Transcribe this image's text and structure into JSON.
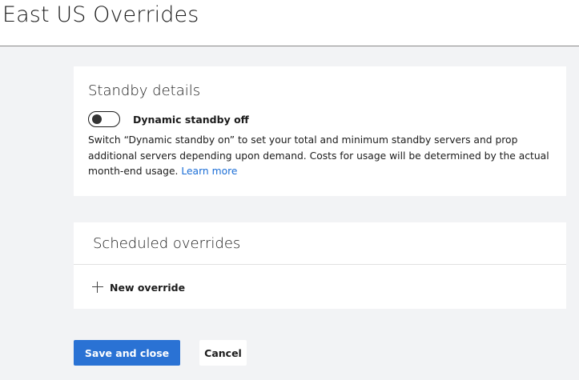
{
  "header": {
    "title": "East US Overrides"
  },
  "standby": {
    "title": "Standby details",
    "toggle": {
      "label": "Dynamic standby off",
      "state": "off"
    },
    "description": "Switch “Dynamic standby on” to set your total and minimum standby servers and prop additional servers depending upon demand. Costs for usage will be determined by the actual month-end usage.",
    "learn_more": "Learn more"
  },
  "overrides": {
    "title": "Scheduled overrides",
    "new_override_label": "New override",
    "new_override_icon": "plus-icon"
  },
  "actions": {
    "save_label": "Save and close",
    "cancel_label": "Cancel"
  },
  "colors": {
    "primary": "#2a72d4",
    "link": "#1a6dd6",
    "background": "#f2f3f5"
  }
}
